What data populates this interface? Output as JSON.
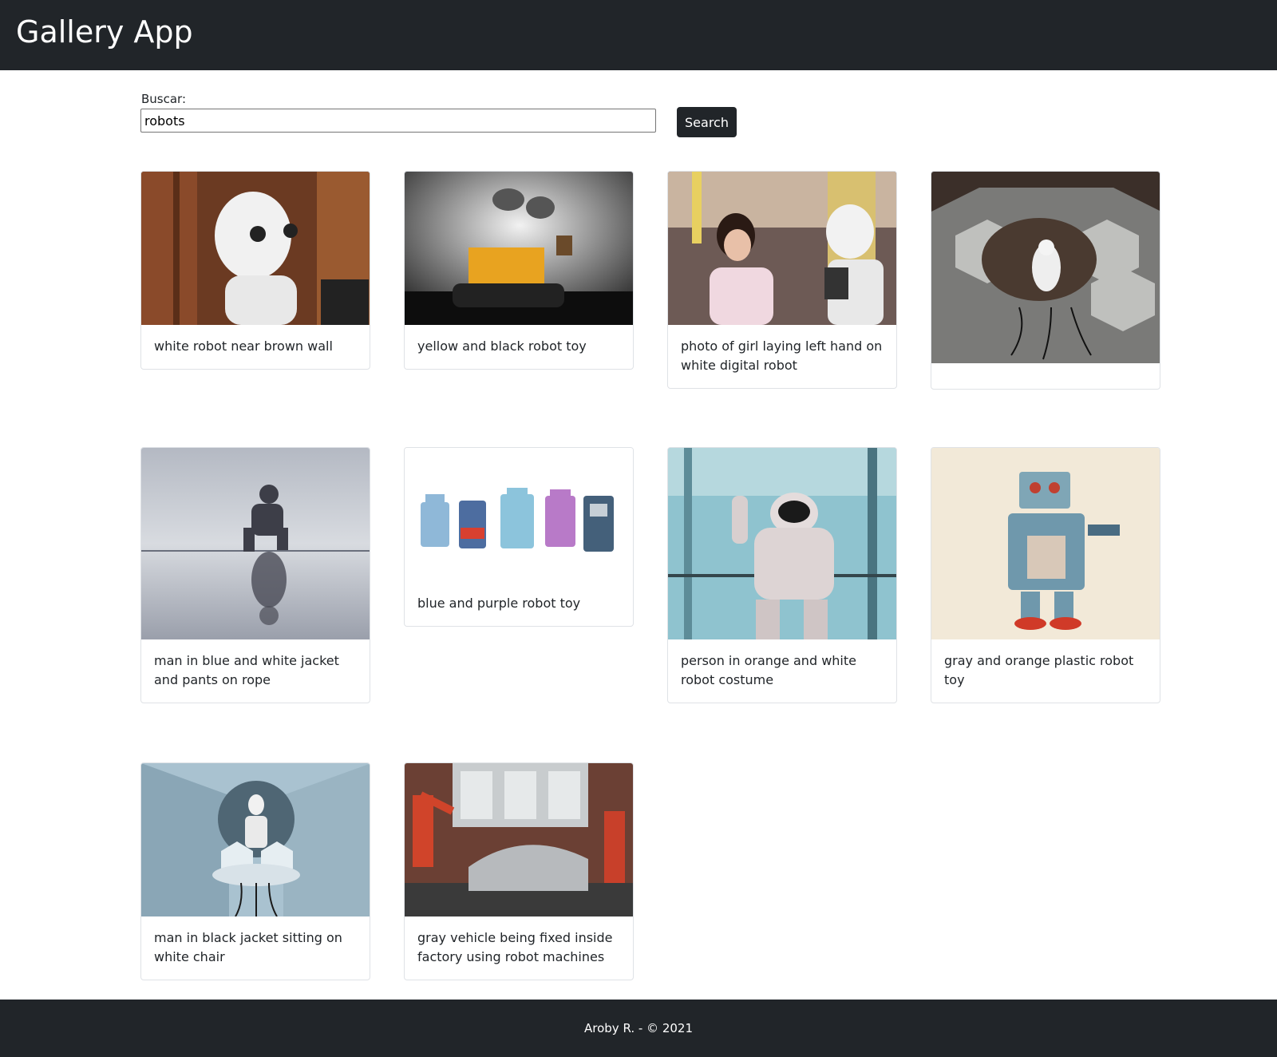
{
  "header": {
    "title": "Gallery App"
  },
  "search": {
    "label": "Buscar:",
    "value": "robots",
    "button_label": "Search"
  },
  "gallery": {
    "items": [
      {
        "caption": "white robot near brown wall"
      },
      {
        "caption": "yellow and black robot toy"
      },
      {
        "caption": "photo of girl laying left hand on white digital robot"
      },
      {
        "caption": ""
      },
      {
        "caption": "man in blue and white jacket and pants on rope"
      },
      {
        "caption": "blue and purple robot toy"
      },
      {
        "caption": "person in orange and white robot costume"
      },
      {
        "caption": "gray and orange plastic robot toy"
      },
      {
        "caption": "man in black jacket sitting on white chair"
      },
      {
        "caption": "gray vehicle being fixed inside factory using robot machines"
      }
    ]
  },
  "footer": {
    "text": "Aroby R. - © 2021"
  }
}
